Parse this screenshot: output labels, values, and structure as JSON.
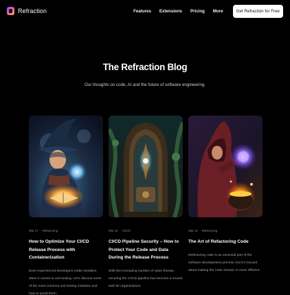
{
  "brand": {
    "name": "Refraction"
  },
  "nav": {
    "links": [
      "Features",
      "Extensions",
      "Pricing",
      "More"
    ],
    "cta_label": "Get Refraction for Free"
  },
  "hero": {
    "title": "The Refraction Blog",
    "subtitle": "Our thoughts on code, AI and the future of software engineering."
  },
  "posts": [
    {
      "date": "Mar 17",
      "category": "Refactoring",
      "title": "How to Optimize Your CI/CD Release Process with Containerization",
      "excerpt": "Even experienced developers make mistakes when it comes to unit testing. Let's discuss some of the most common unit testing mistakes and how to avoid them."
    },
    {
      "date": "Mar 16",
      "category": "CI/CD",
      "title": "CI/CD Pipeline Security – How to Protect Your Code and Data During the Release Process",
      "excerpt": "With the increasing number of cyber threats, securing the CI/CD pipeline has become a crucial task for organizations."
    },
    {
      "date": "Mar 13",
      "category": "Refactoring",
      "title": "The Art of Refactoring Code",
      "excerpt": "Refactoring code is an essential part of the software development process, but it's not just about making the code cleaner or more efficient."
    }
  ],
  "colors": {
    "background": "#000000",
    "cta_background": "#ffffff",
    "muted_text": "#a9a9a9"
  }
}
